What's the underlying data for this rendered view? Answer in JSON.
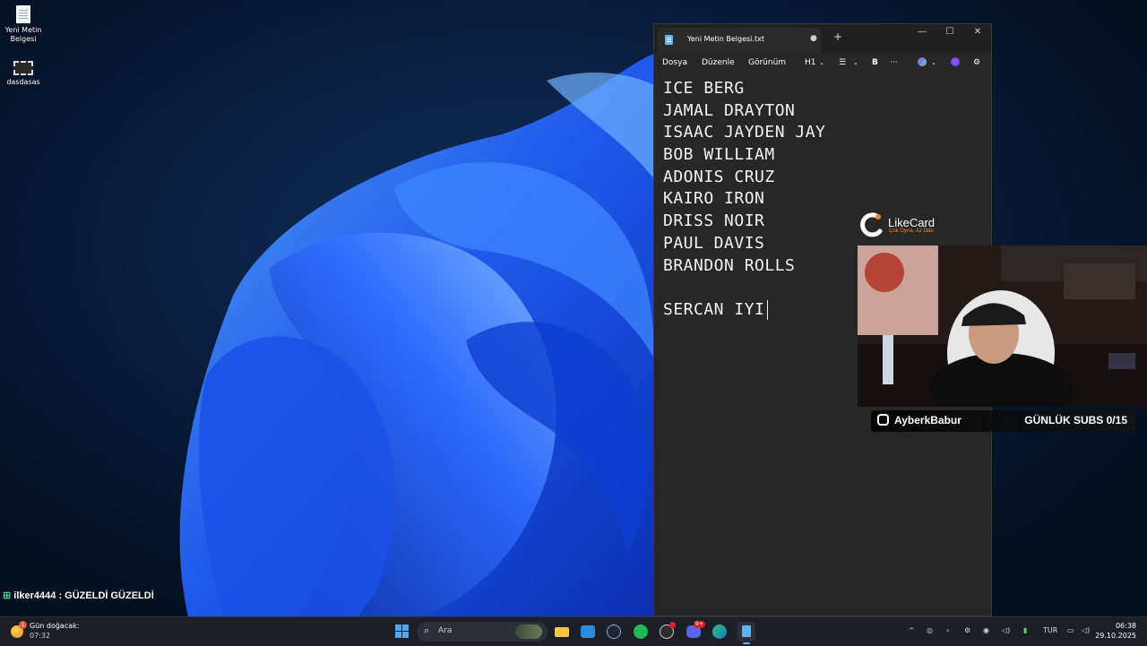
{
  "desktop": {
    "icons": [
      {
        "label": "Yeni Metin Belgesi"
      },
      {
        "label": "dasdasas"
      }
    ]
  },
  "notepad": {
    "tab_title": "Yeni Metin Belgesi.txt",
    "tab_unsaved_marker": "●",
    "new_tab": "+",
    "window_controls": {
      "minimize": "—",
      "maximize": "☐",
      "close": "✕"
    },
    "menu": {
      "file": "Dosya",
      "edit": "Düzenle",
      "view": "Görünüm",
      "heading": "H1",
      "bold": "B",
      "more": "···"
    },
    "lines": [
      "ICE BERG",
      "JAMAL DRAYTON",
      "ISAAC JAYDEN JAY",
      "BOB WILLIAM",
      "ADONIS CRUZ",
      "KAIRO IRON",
      "DRISS NOIR",
      "PAUL DAVIS",
      "BRANDON ROLLS",
      "",
      "SERCAN IYI"
    ]
  },
  "overlay": {
    "sponsor_name": "LikeCard",
    "sponsor_tagline": "Çok Oyna, Az Öde",
    "streamer": "AyberkBabur",
    "subs": "GÜNLÜK SUBS 0/15",
    "chat_user": "ilker4444",
    "chat_message": " : GÜZELDİ GÜZELDİ"
  },
  "taskbar": {
    "weather_title": "Gün doğacak:",
    "weather_time": "07:32",
    "weather_badge": "1",
    "search_placeholder": "Ara",
    "language": "TUR",
    "time": "06:38",
    "date": "29.10.2025",
    "discord_badge": "9+"
  },
  "colors": {
    "accent": "#0078d4",
    "editor_bg": "#272727",
    "taskbar_bg": "#1c1f26"
  }
}
